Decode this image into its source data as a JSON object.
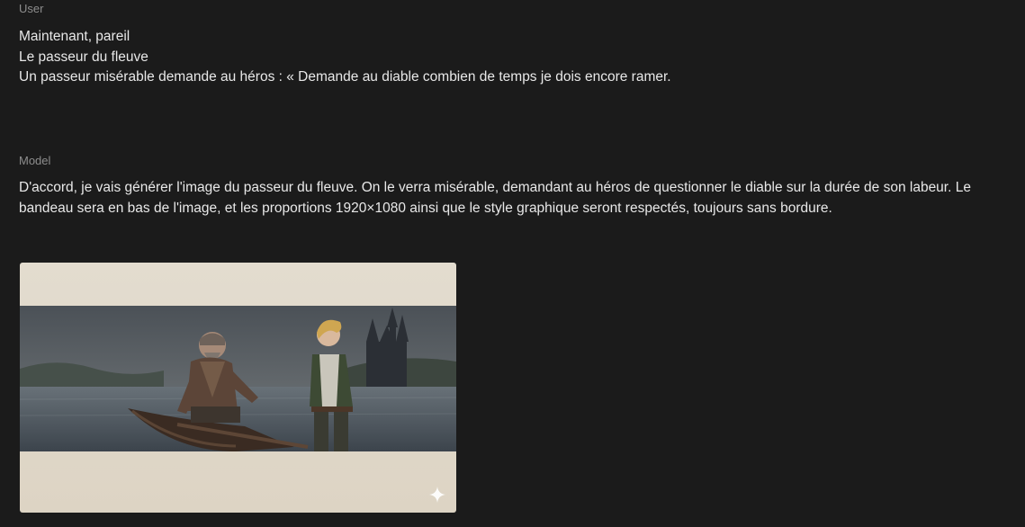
{
  "conversation": {
    "user": {
      "label": "User",
      "message": "Maintenant, pareil\nLe passeur du fleuve\nUn passeur misérable demande au héros : « Demande au diable combien de temps je dois encore ramer."
    },
    "model": {
      "label": "Model",
      "message": "D'accord, je vais générer l'image du passeur du fleuve. On le verra misérable, demandant au héros de questionner le diable sur la durée de son labeur. Le bandeau sera en bas de l'image, et les proportions 1920×1080 ainsi que le style graphique seront respectés, toujours sans bordure."
    }
  },
  "image": {
    "subject": "ferryman-and-hero-illustration",
    "icon": "sparkle-icon"
  }
}
